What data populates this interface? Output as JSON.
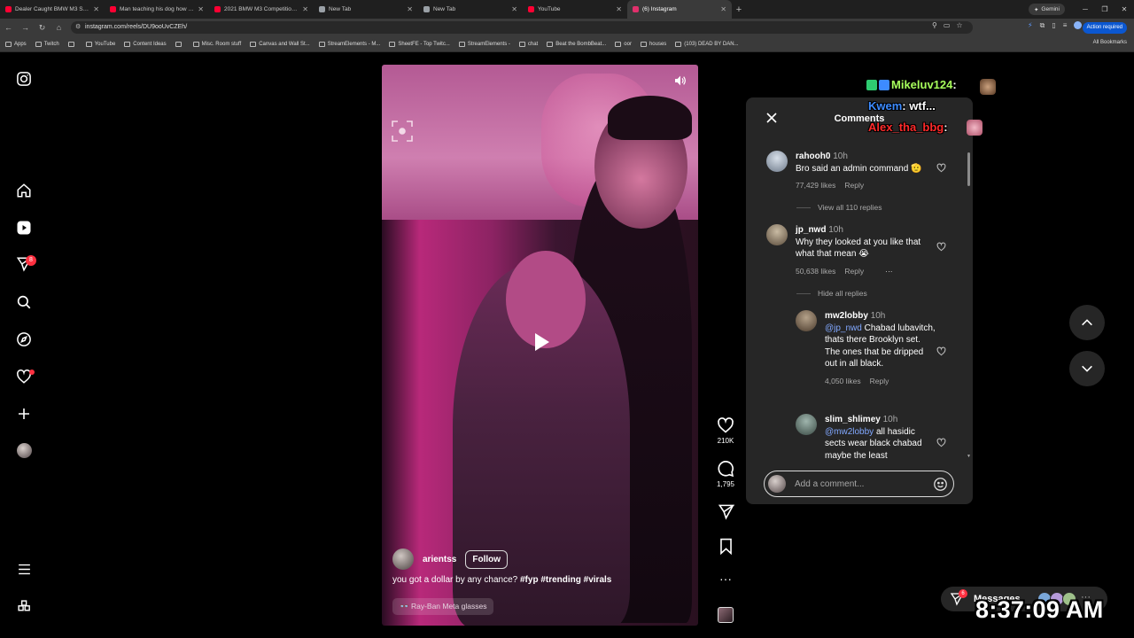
{
  "browser": {
    "tabs": [
      {
        "label": "Dealer Caught BMW M3 Scam",
        "favicon_color": "#ff0033",
        "active": false
      },
      {
        "label": "Man teaching his dog how to ...",
        "favicon_color": "#ff0033",
        "active": false
      },
      {
        "label": "2021 BMW M3 Competition Re...",
        "favicon_color": "#ff0033",
        "active": false
      },
      {
        "label": "New Tab",
        "favicon_color": "#9aa0a6",
        "active": false
      },
      {
        "label": "New Tab",
        "favicon_color": "#9aa0a6",
        "active": false
      },
      {
        "label": "YouTube",
        "favicon_color": "#ff0033",
        "active": false
      },
      {
        "label": "(6) Instagram",
        "favicon_color": "#e1306c",
        "active": true
      }
    ],
    "new_tab_label": "+",
    "gemini_label": "Gemini",
    "url": "instagram.com/reels/DU9ooUvCZEh/",
    "action_required_label": "Action required",
    "bookmarks": [
      "Apps",
      "Twitch",
      "",
      "YouTube",
      "Content Ideas",
      "",
      "Misc. Room stuff",
      "Canvas and Wall St...",
      "StreamElements - M...",
      "SheetFE - Top Twitc...",
      "StreamElements -",
      "chat",
      "Beat the BombBeat...",
      "oor",
      "houses",
      "(103) DEAD BY DAN..."
    ],
    "all_bookmarks_label": "All Bookmarks"
  },
  "instagram": {
    "rail": [
      {
        "name": "instagram-logo-icon"
      },
      {
        "name": "home-icon"
      },
      {
        "name": "reels-icon"
      },
      {
        "name": "direct-icon",
        "badge": "8"
      },
      {
        "name": "search-icon"
      },
      {
        "name": "explore-icon"
      },
      {
        "name": "notifications-icon"
      },
      {
        "name": "create-icon"
      },
      {
        "name": "profile-avatar"
      },
      {
        "name": "more-menu-icon"
      },
      {
        "name": "also-from-meta-icon"
      }
    ],
    "reel": {
      "author": "arientss",
      "follow_label": "Follow",
      "caption_text": "you got a dollar by any chance? ",
      "caption_tags": "#fyp #trending #virals",
      "product_tag": "Ray-Ban Meta glasses",
      "likes": "210K",
      "comments": "1,795"
    },
    "comments_panel": {
      "title": "Comments",
      "items": [
        {
          "user": "rahooh0",
          "time": "10h",
          "text": "Bro said an admin command 🫡",
          "likes": "77,429 likes",
          "reply": "Reply"
        },
        {
          "user": "jp_nwd",
          "time": "10h",
          "text": "Why they looked at you like that what that mean 😭",
          "likes": "50,638 likes",
          "reply": "Reply",
          "more": "···"
        },
        {
          "user": "mw2lobby",
          "time": "10h",
          "mention": "@jp_nwd",
          "text": " Chabad lubavitch, thats there Brooklyn set. The ones that be dripped out in all black.",
          "likes": "4,050 likes",
          "reply": "Reply"
        },
        {
          "user": "slim_shlimey",
          "time": "10h",
          "mention": "@mw2lobby",
          "text": " all hasidic sects wear black chabad maybe the least"
        }
      ],
      "view_replies_label": "View all 110 replies",
      "hide_replies_label": "Hide all replies",
      "add_comment_placeholder": "Add a comment..."
    },
    "messages_label": "Messages",
    "messages_badge": "6"
  },
  "overlay": {
    "chat": [
      {
        "user": "Mikeluv124",
        "text": "",
        "color": "#a8ff5c"
      },
      {
        "user": "Kwem",
        "text": "wtf...",
        "color": "#3d8bff"
      },
      {
        "user": "Alex_tha_bbg",
        "text": "",
        "color": "#ff2a2a"
      }
    ],
    "clock": "8:37:09 AM"
  }
}
